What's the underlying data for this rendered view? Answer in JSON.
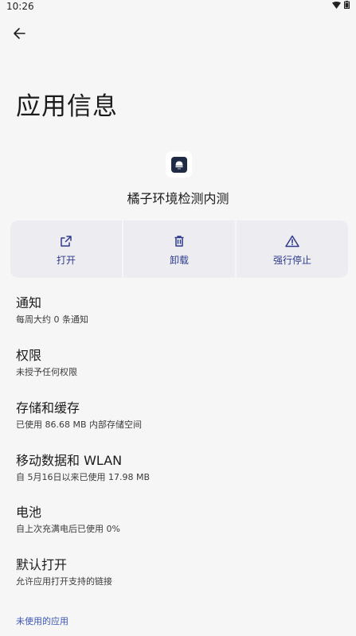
{
  "status": {
    "time": "10:26"
  },
  "header": {
    "title": "应用信息"
  },
  "app": {
    "name": "橘子环境检测内测"
  },
  "actions": [
    {
      "label": "打开",
      "icon": "open-external-icon"
    },
    {
      "label": "卸载",
      "icon": "trash-icon"
    },
    {
      "label": "强行停止",
      "icon": "warning-icon"
    }
  ],
  "settings": [
    {
      "title": "通知",
      "subtitle": "每周大约 0 条通知"
    },
    {
      "title": "权限",
      "subtitle": "未授予任何权限"
    },
    {
      "title": "存储和缓存",
      "subtitle": "已使用 86.68 MB 内部存储空间"
    },
    {
      "title": "移动数据和 WLAN",
      "subtitle": "自 5月16日以来已使用 17.98 MB"
    },
    {
      "title": "电池",
      "subtitle": "自上次充满电后已使用 0%"
    },
    {
      "title": "默认打开",
      "subtitle": "允许应用打开支持的链接"
    }
  ],
  "footer": {
    "unused_apps": "未使用的应用"
  },
  "colors": {
    "accent": "#2e3a8c",
    "link": "#3b55b5",
    "background": "#f6f6f6",
    "button_bg": "#ededf1"
  }
}
